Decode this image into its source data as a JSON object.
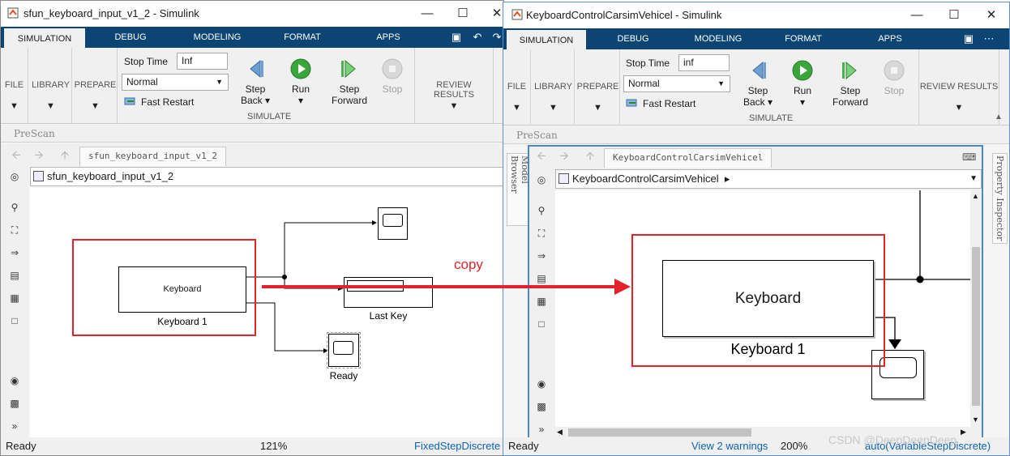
{
  "left_window": {
    "title": "sfun_keyboard_input_v1_2 - Simulink",
    "tabs": [
      "SIMULATION",
      "DEBUG",
      "MODELING",
      "FORMAT",
      "APPS"
    ],
    "ribbon": {
      "sections": [
        "FILE",
        "LIBRARY",
        "PREPARE"
      ],
      "stop_time_label": "Stop Time",
      "stop_time_value": "Inf",
      "mode_value": "Normal",
      "fast_restart": "Fast Restart",
      "step_back": [
        "Step",
        "Back"
      ],
      "run": "Run",
      "step_forward": [
        "Step",
        "Forward"
      ],
      "stop": "Stop",
      "simulate_label": "SIMULATE",
      "review_results": "REVIEW RESULTS"
    },
    "prescan": "PreScan",
    "canvas_tab": "sfun_keyboard_input_v1_2",
    "address": "sfun_keyboard_input_v1_2",
    "blocks": {
      "keyboard": "Keyboard",
      "keyboard_label": "Keyboard 1",
      "last_key": "Last Key",
      "ready": "Ready"
    },
    "status": {
      "left": "Ready",
      "zoom": "121%",
      "solver": "FixedStepDiscrete"
    }
  },
  "right_window": {
    "title": "KeyboardControlCarsimVehicel - Simulink",
    "tabs": [
      "SIMULATION",
      "DEBUG",
      "MODELING",
      "FORMAT",
      "APPS"
    ],
    "ribbon": {
      "sections": [
        "FILE",
        "LIBRARY",
        "PREPARE"
      ],
      "stop_time_label": "Stop Time",
      "stop_time_value": "inf",
      "mode_value": "Normal",
      "fast_restart": "Fast Restart",
      "step_back": [
        "Step",
        "Back"
      ],
      "run": "Run",
      "step_forward": [
        "Step",
        "Forward"
      ],
      "stop": "Stop",
      "simulate_label": "SIMULATE",
      "review_results": "REVIEW RESULTS"
    },
    "prescan": "PreScan",
    "model_browser": "Model Browser",
    "property_inspector": "Property Inspector",
    "canvas_tab": "KeyboardControlCarsimVehicel",
    "address": "KeyboardControlCarsimVehicel",
    "blocks": {
      "keyboard": "Keyboard",
      "keyboard_label": "Keyboard 1"
    },
    "status": {
      "left": "Ready",
      "warnings": "View 2 warnings",
      "zoom": "200%",
      "solver": "auto(VariableStepDiscrete)"
    }
  },
  "annotation": {
    "copy_label": "copy",
    "color": "#e3222b"
  },
  "watermark": "CSDN @DeepDeepDeep"
}
